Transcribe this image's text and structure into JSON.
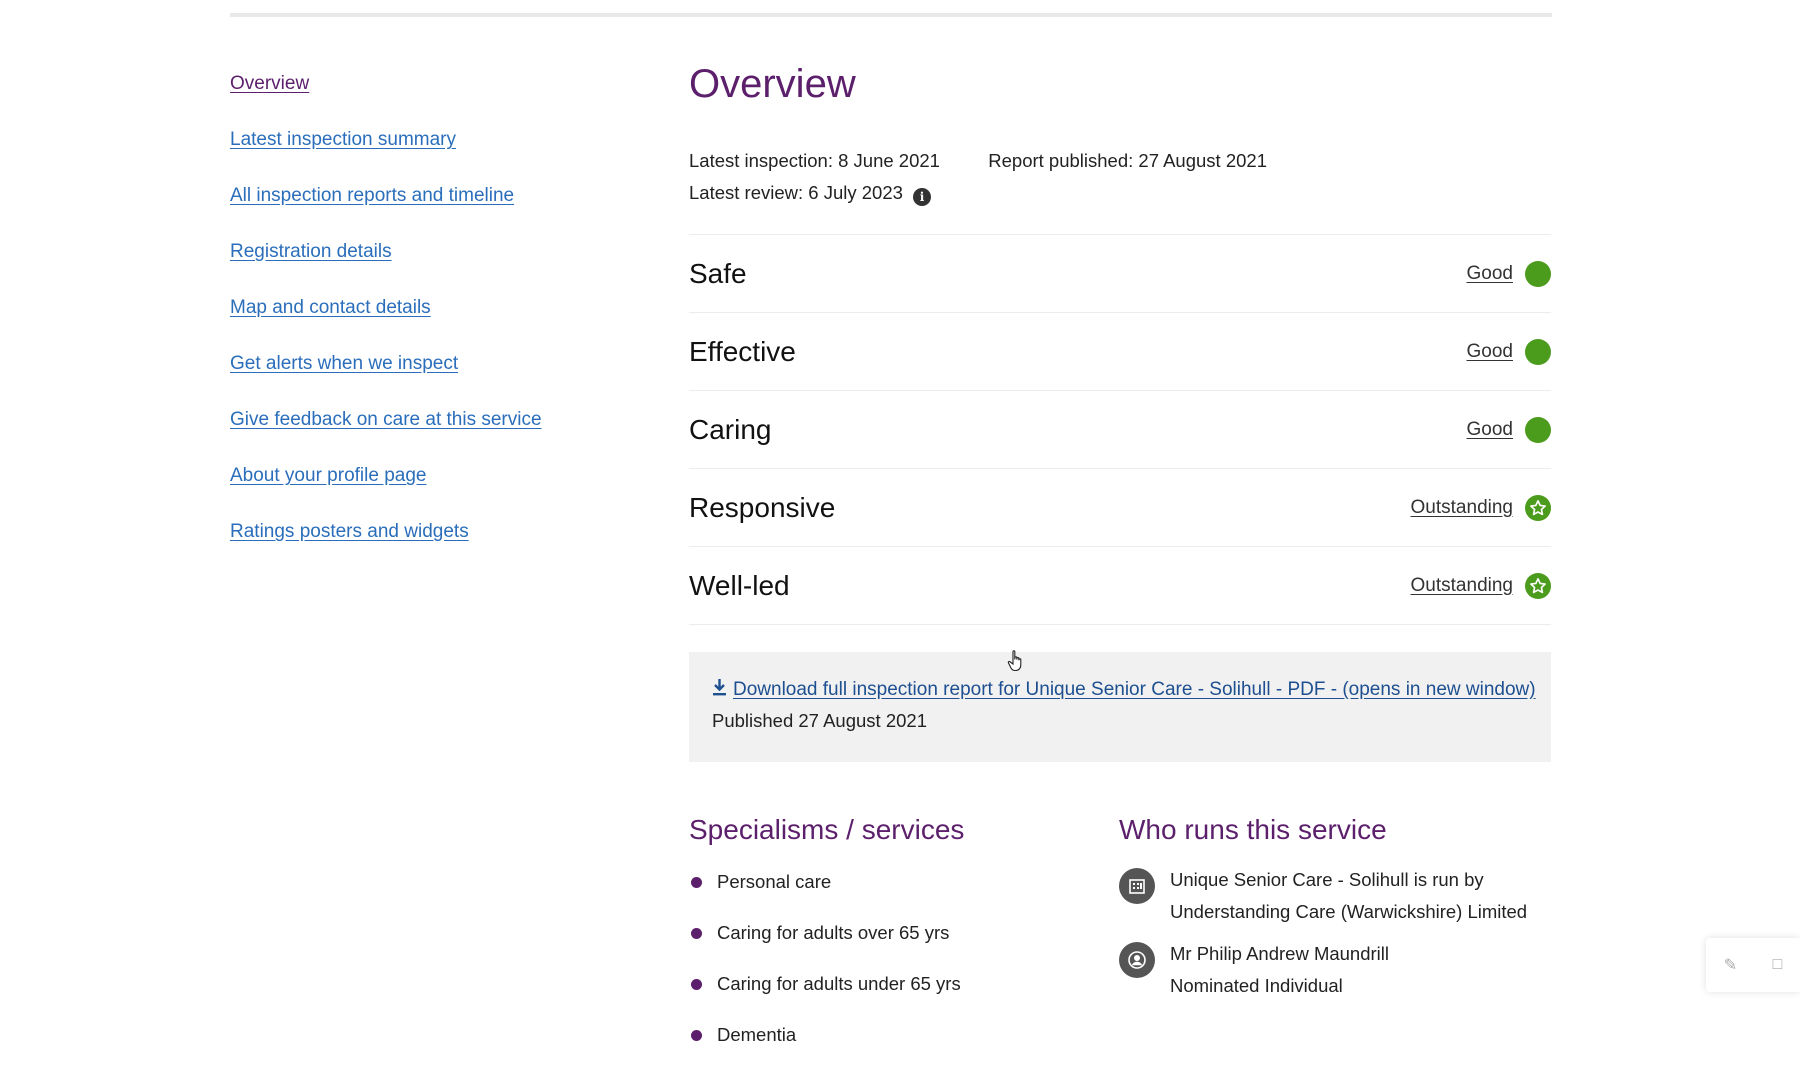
{
  "nav": {
    "items": [
      {
        "label": "Overview",
        "active": true
      },
      {
        "label": "Latest inspection summary"
      },
      {
        "label": "All inspection reports and timeline"
      },
      {
        "label": "Registration details"
      },
      {
        "label": "Map and contact details"
      },
      {
        "label": "Get alerts when we inspect"
      },
      {
        "label": "Give feedback on care at this service"
      },
      {
        "label": "About your profile page"
      },
      {
        "label": "Ratings posters and widgets"
      }
    ]
  },
  "overview": {
    "title": "Overview",
    "latest_inspection": "Latest inspection: 8 June 2021",
    "report_published": "Report published: 27 August 2021",
    "latest_review": "Latest review: 6 July 2023",
    "info_glyph": "i",
    "ratings": [
      {
        "label": "Safe",
        "value": "Good",
        "icon": "good-dot-icon"
      },
      {
        "label": "Effective",
        "value": "Good",
        "icon": "good-dot-icon"
      },
      {
        "label": "Caring",
        "value": "Good",
        "icon": "good-dot-icon"
      },
      {
        "label": "Responsive",
        "value": "Outstanding",
        "icon": "outstanding-star-icon"
      },
      {
        "label": "Well-led",
        "value": "Outstanding",
        "icon": "outstanding-star-icon"
      }
    ],
    "download": {
      "link": "Download full inspection report for Unique Senior Care - Solihull - PDF - (opens in new window)",
      "published": "Published 27 August 2021"
    }
  },
  "specialisms": {
    "heading": "Specialisms / services",
    "items": [
      "Personal care",
      "Caring for adults over 65 yrs",
      "Caring for adults under 65 yrs",
      "Dementia"
    ]
  },
  "who_runs": {
    "heading": "Who runs this service",
    "provider_line1": "Unique Senior Care - Solihull is run by",
    "provider_line2": "Understanding Care (Warwickshire) Limited",
    "person_name": "Mr Philip Andrew Maundrill",
    "person_role": "Nominated Individual"
  },
  "colors": {
    "brand_purple": "#5c1f6b",
    "link_blue": "#2a6ebb",
    "rating_green": "#4b9b1c"
  }
}
